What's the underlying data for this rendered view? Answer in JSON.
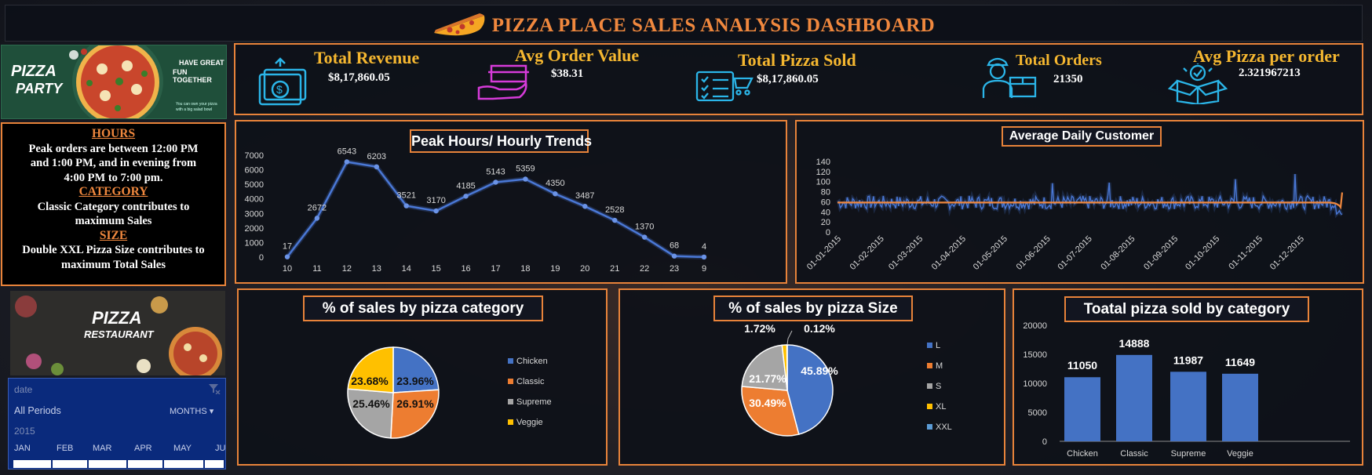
{
  "title": "PIZZA PLACE SALES ANALYSIS DASHBOARD",
  "kpis": [
    {
      "label": "Total Revenue",
      "value": "$8,17,860.05",
      "icon": "money-stack-icon",
      "color": "#2bb5e8"
    },
    {
      "label": "Avg Order Value",
      "value": "$38.31",
      "icon": "hand-box-icon",
      "color": "#d63bd9"
    },
    {
      "label": "Total Pizza Sold",
      "value": "$8,17,860.05",
      "icon": "checklist-icon",
      "color": "#2bb5e8"
    },
    {
      "label": "Total Orders",
      "value": "21350",
      "icon": "delivery-person-icon",
      "color": "#2bb5e8"
    },
    {
      "label": "Avg Pizza per order",
      "value": "2.321967213",
      "icon": "open-box-icon",
      "color": "#2bb5e8"
    }
  ],
  "banner_top": {
    "line1": "PIZZA",
    "line2": "PARTY",
    "tagline1": "HAVE GREAT",
    "tagline2": "FUN TOGETHER",
    "small1": "You can own your pizza",
    "small2": "with a big salad bowl"
  },
  "banner_bottom": {
    "line1": "PIZZA",
    "line2": "RESTAURANT"
  },
  "insights": {
    "h1": "HOURS",
    "t1a": "Peak orders are between 12:00 PM",
    "t1b": "and 1:00 PM, and in evening from",
    "t1c": "4:00 PM to 7:00 pm.",
    "h2": "CATEGORY",
    "t2a": "Classic Category contributes to",
    "t2b": "maximum Sales",
    "h3": "SIZE",
    "t3a": "Double XXL Pizza Size contributes to",
    "t3b": "maximum Total Sales"
  },
  "slicer": {
    "field": "date",
    "selection": "All Periods",
    "level": "MONTHS",
    "year": "2015",
    "months": [
      "JAN",
      "FEB",
      "MAR",
      "APR",
      "MAY",
      "JU"
    ]
  },
  "chart_data": [
    {
      "type": "line",
      "title": "Peak Hours/ Hourly Trends",
      "categories": [
        "10",
        "11",
        "12",
        "13",
        "14",
        "15",
        "16",
        "17",
        "18",
        "19",
        "20",
        "21",
        "22",
        "23",
        "9"
      ],
      "values": [
        17,
        2672,
        6543,
        6203,
        3521,
        3170,
        4185,
        5143,
        5359,
        4350,
        3487,
        2528,
        1370,
        68,
        4
      ],
      "yticks": [
        "0",
        "1000",
        "2000",
        "3000",
        "4000",
        "5000",
        "6000",
        "7000"
      ],
      "ylim": [
        0,
        7000
      ],
      "color": "#4a78d6"
    },
    {
      "type": "line",
      "title": "Average Daily Customer",
      "xticks": [
        "01-01-2015",
        "01-02-2015",
        "01-03-2015",
        "01-04-2015",
        "01-05-2015",
        "01-06-2015",
        "01-07-2015",
        "01-08-2015",
        "01-09-2015",
        "01-10-2015",
        "01-11-2015",
        "01-12-2015"
      ],
      "yticks": [
        "0",
        "20",
        "40",
        "60",
        "80",
        "100",
        "120",
        "140"
      ],
      "ylim": [
        0,
        140
      ],
      "color": "#4a78d6",
      "trend_color": "#f0883e",
      "typical_range": [
        45,
        72
      ],
      "peaks": [
        {
          "x": "2015-11-27",
          "y": 115
        },
        {
          "x": "2015-10-15",
          "y": 105
        },
        {
          "x": "2015-07-16",
          "y": 98
        },
        {
          "x": "2015-06-05",
          "y": 97
        }
      ]
    },
    {
      "type": "pie",
      "title": "% of sales by pizza category",
      "labels": [
        "Chicken",
        "Classic",
        "Supreme",
        "Veggie"
      ],
      "values": [
        23.96,
        26.91,
        25.46,
        23.68
      ],
      "data_labels": [
        "23.96%",
        "26.91%",
        "25.46%",
        "23.68%"
      ],
      "colors": [
        "#4472c4",
        "#ed7d31",
        "#a5a5a5",
        "#ffc000"
      ]
    },
    {
      "type": "pie",
      "title": "% of sales by pizza Size",
      "labels": [
        "L",
        "M",
        "S",
        "XL",
        "XXL"
      ],
      "values": [
        45.89,
        30.49,
        21.77,
        1.72,
        0.12
      ],
      "data_labels": [
        "45.89%",
        "30.49%",
        "21.77%",
        "1.72%",
        "0.12%"
      ],
      "colors": [
        "#4472c4",
        "#ed7d31",
        "#a5a5a5",
        "#ffc000",
        "#5b9bd5"
      ]
    },
    {
      "type": "bar",
      "title": "Toatal pizza sold by category",
      "categories": [
        "Chicken",
        "Classic",
        "Supreme",
        "Veggie"
      ],
      "values": [
        11050,
        14888,
        11987,
        11649
      ],
      "yticks": [
        "0",
        "5000",
        "10000",
        "15000",
        "20000"
      ],
      "ylim": [
        0,
        20000
      ],
      "color": "#4472c4"
    }
  ]
}
